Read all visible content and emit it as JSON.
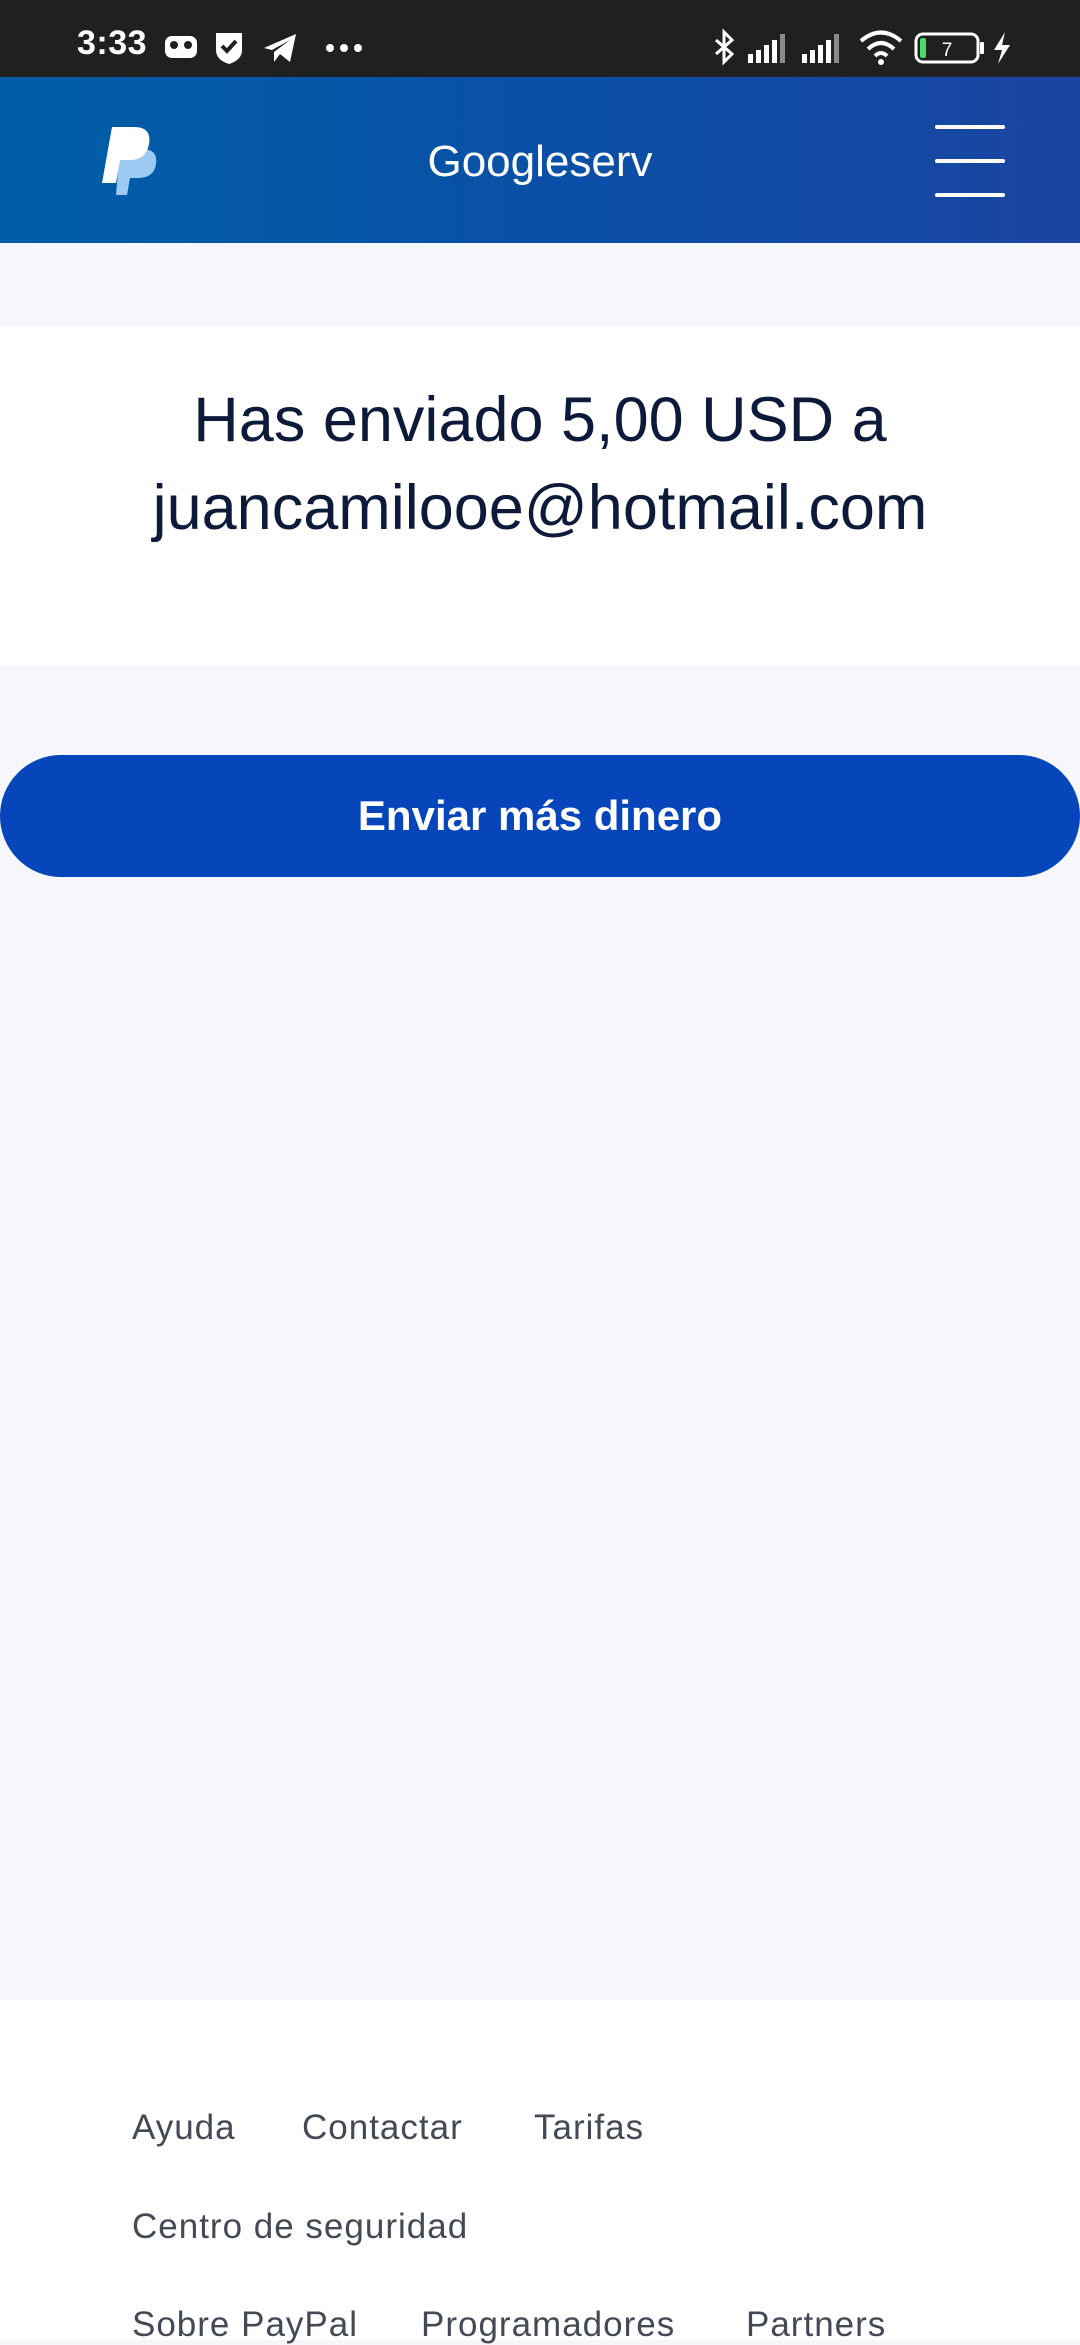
{
  "status_bar": {
    "time": "3:33",
    "left_icons": [
      "game-controller-icon",
      "shield-check-icon",
      "telegram-icon",
      "more-dots-icon"
    ],
    "right_icons": [
      "bluetooth-icon",
      "signal-icon",
      "signal-icon",
      "wifi-icon",
      "battery-icon",
      "charging-icon"
    ],
    "battery_level": "7"
  },
  "header": {
    "logo_icon": "paypal-logo-icon",
    "title": "Googleserv",
    "menu_icon": "hamburger-menu-icon",
    "colors": {
      "gradient_start": "#005ea6",
      "gradient_end": "#1a44a0"
    }
  },
  "confirmation": {
    "line1": "Has enviado 5,00 USD a",
    "line2": "juancamilooe@hotmail.com"
  },
  "actions": {
    "send_more_label": "Enviar más dinero",
    "button_color": "#0645ba"
  },
  "footer": {
    "links": [
      "Ayuda",
      "Contactar",
      "Tarifas",
      "Centro de seguridad",
      "Sobre PayPal",
      "Programadores",
      "Partners"
    ]
  }
}
